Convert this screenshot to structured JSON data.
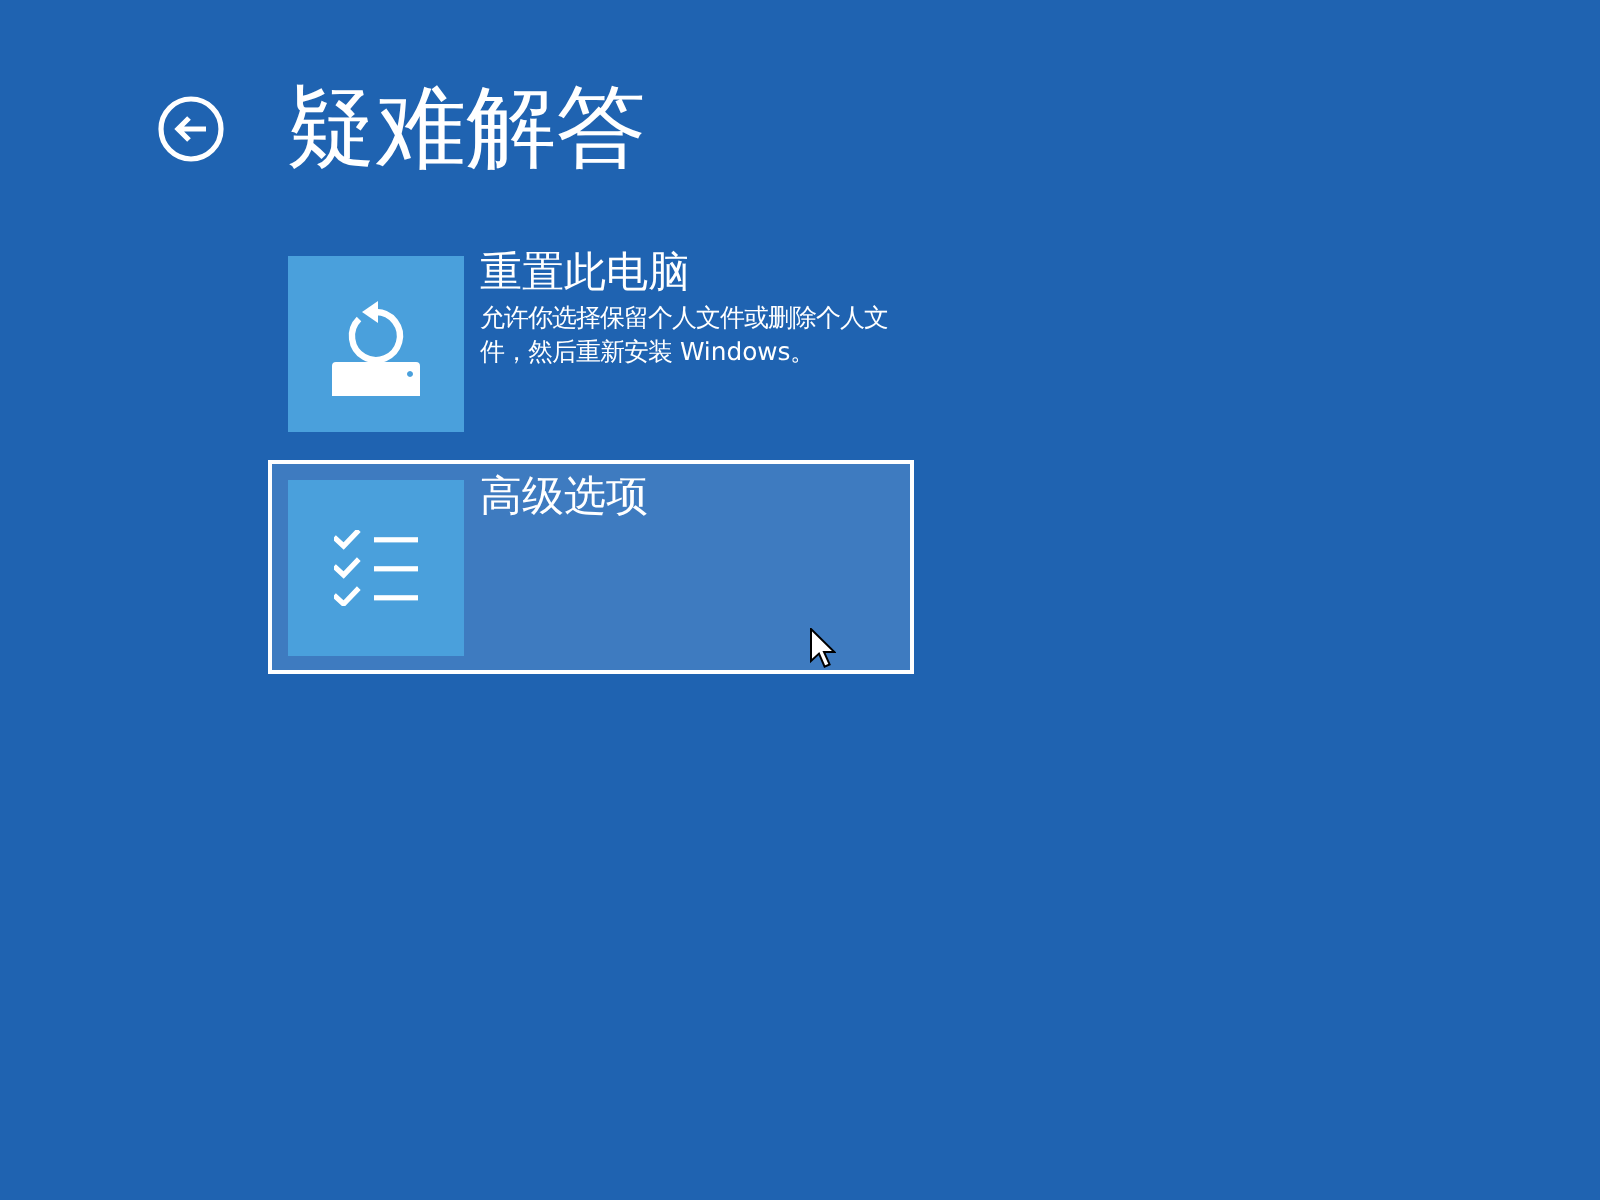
{
  "header": {
    "title": "疑难解答"
  },
  "options": [
    {
      "kind": "reset",
      "title": "重置此电脑",
      "description": "允许你选择保留个人文件或删除个人文件，然后重新安装 Windows。",
      "selected": false
    },
    {
      "kind": "advanced",
      "title": "高级选项",
      "selected": true
    }
  ]
}
